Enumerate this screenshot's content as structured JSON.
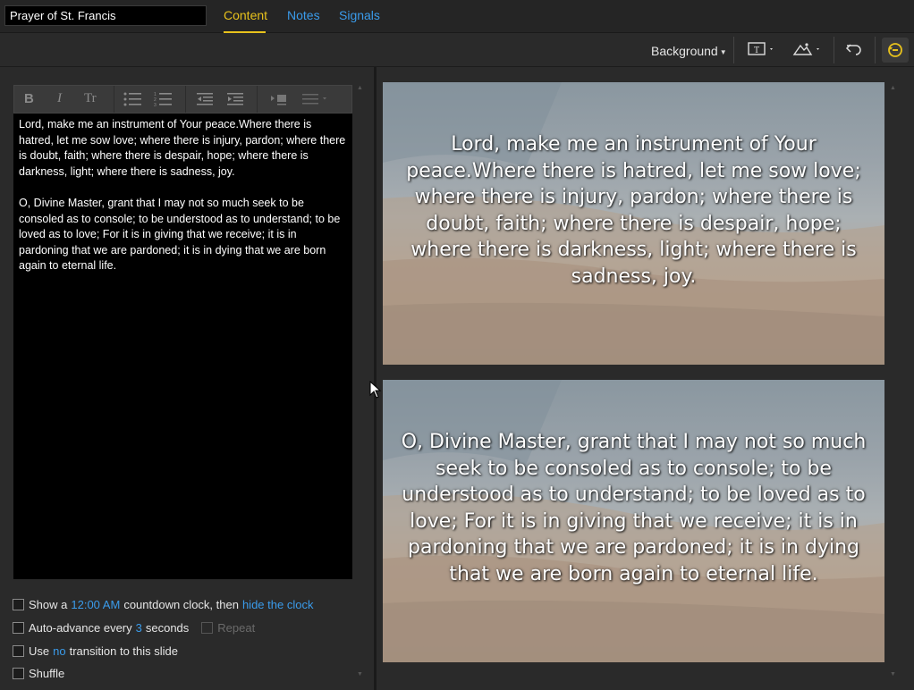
{
  "header": {
    "title_value": "Prayer of St. Francis",
    "tabs": [
      {
        "label": "Content"
      },
      {
        "label": "Notes"
      },
      {
        "label": "Signals"
      }
    ]
  },
  "toolbar": {
    "background_label": "Background",
    "icons": [
      "text-box-icon",
      "image-icon",
      "undo-icon",
      "sync-icon"
    ]
  },
  "editor": {
    "buttons": [
      "B",
      "I",
      "Tr"
    ],
    "paragraphs": [
      "Lord, make me an instrument of Your peace.Where there is hatred, let me sow love; where there is injury, pardon; where there is doubt, faith; where there is despair, hope; where there is darkness, light; where there is sadness, joy.",
      "O, Divine Master, grant that I may not so much seek to be consoled as to console; to be understood as to understand; to be loved as to love; For it is in giving that we receive; it is in pardoning that we are pardoned; it is in dying that we are born again to eternal life."
    ]
  },
  "options": {
    "clock": {
      "prefix": "Show a",
      "time": "12:00 AM",
      "middle": "countdown clock, then",
      "action": "hide the clock"
    },
    "advance": {
      "prefix": "Auto-advance every",
      "seconds": "3",
      "suffix": "seconds",
      "repeat": "Repeat"
    },
    "transition": {
      "prefix": "Use",
      "value": "no",
      "suffix": "transition to this slide"
    },
    "shuffle": {
      "label": "Shuffle"
    }
  },
  "slides": [
    {
      "text": "Lord, make me an instrument of Your peace.Where there is hatred, let me sow love; where there is injury, pardon; where there is doubt, faith; where there is despair, hope; where there is darkness, light; where there is sadness, joy."
    },
    {
      "text": "O, Divine Master, grant that I may not so much seek to be consoled as to console; to be understood as to understand; to be loved as to love; For it is in giving that we receive; it is in pardoning that we are pardoned; it is in dying that we are born again to eternal life."
    }
  ],
  "colors": {
    "accent_active": "#e8c21c",
    "link": "#3a9bea",
    "background": "#2a2a2a"
  }
}
